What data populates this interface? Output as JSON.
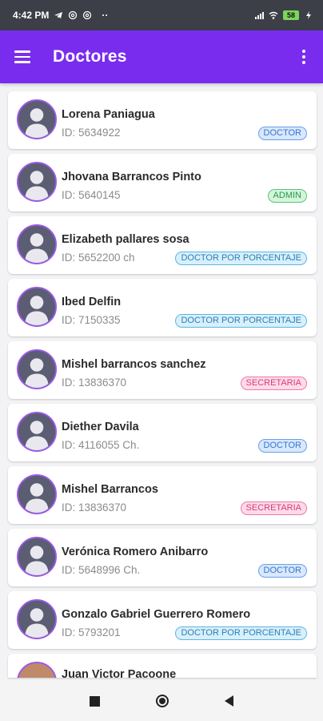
{
  "status_bar": {
    "time": "4:42 PM",
    "notification_icons": [
      "telegram-icon",
      "at-icon",
      "at-icon"
    ],
    "more_dots": "··",
    "battery_level": "58"
  },
  "app_bar": {
    "title": "Doctores",
    "background_color": "#7a2cee"
  },
  "doctors": [
    {
      "name": "Lorena Paniagua",
      "id_text": "ID: 5634922",
      "role": "DOCTOR",
      "role_type": "doctor"
    },
    {
      "name": "Jhovana Barrancos Pinto",
      "id_text": "ID: 5640145",
      "role": "ADMIN",
      "role_type": "admin"
    },
    {
      "name": "Elizabeth pallares sosa",
      "id_text": "ID: 5652200 ch",
      "role": "DOCTOR POR PORCENTAJE",
      "role_type": "porcentaje"
    },
    {
      "name": "Ibed Delfin",
      "id_text": "ID: 7150335",
      "role": "DOCTOR POR PORCENTAJE",
      "role_type": "porcentaje"
    },
    {
      "name": "Mishel barrancos sanchez",
      "id_text": "ID: 13836370",
      "role": "SECRETARIA",
      "role_type": "secretaria"
    },
    {
      "name": "Diether Davila",
      "id_text": "ID: 4116055 Ch.",
      "role": "DOCTOR",
      "role_type": "doctor"
    },
    {
      "name": "Mishel Barrancos",
      "id_text": "ID: 13836370",
      "role": "SECRETARIA",
      "role_type": "secretaria"
    },
    {
      "name": "Verónica Romero Anibarro",
      "id_text": "ID: 5648996 Ch.",
      "role": "DOCTOR",
      "role_type": "doctor"
    },
    {
      "name": "Gonzalo Gabriel Guerrero Romero",
      "id_text": "ID: 5793201",
      "role": "DOCTOR POR PORCENTAJE",
      "role_type": "porcentaje"
    }
  ],
  "partial_item": {
    "name": "Juan Victor Pacoone"
  },
  "badge_colors": {
    "doctor": "#3a74c9",
    "admin": "#279a45",
    "porcentaje": "#2c7fb5",
    "secretaria": "#d33d7e"
  }
}
